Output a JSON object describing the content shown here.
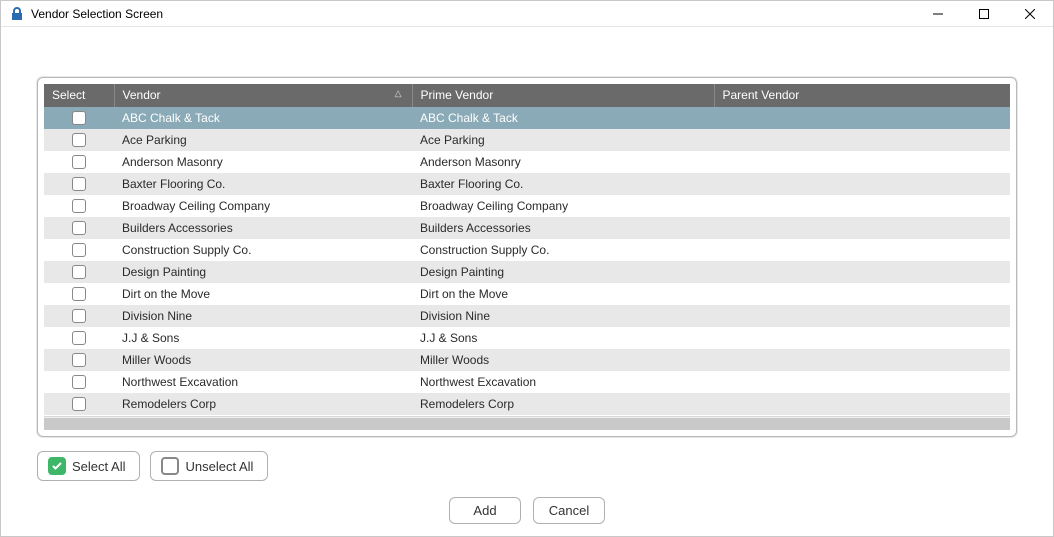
{
  "window": {
    "title": "Vendor Selection Screen"
  },
  "columns": {
    "select": "Select",
    "vendor": "Vendor",
    "prime": "Prime Vendor",
    "parent": "Parent Vendor"
  },
  "rows": [
    {
      "checked": false,
      "vendor": "ABC Chalk & Tack",
      "prime": "ABC Chalk & Tack",
      "parent": "",
      "selected": true
    },
    {
      "checked": false,
      "vendor": "Ace Parking",
      "prime": "Ace Parking",
      "parent": "",
      "selected": false
    },
    {
      "checked": false,
      "vendor": "Anderson Masonry",
      "prime": "Anderson Masonry",
      "parent": "",
      "selected": false
    },
    {
      "checked": false,
      "vendor": "Baxter Flooring Co.",
      "prime": "Baxter Flooring Co.",
      "parent": "",
      "selected": false
    },
    {
      "checked": false,
      "vendor": "Broadway Ceiling Company",
      "prime": "Broadway Ceiling Company",
      "parent": "",
      "selected": false
    },
    {
      "checked": false,
      "vendor": "Builders Accessories",
      "prime": "Builders Accessories",
      "parent": "",
      "selected": false
    },
    {
      "checked": false,
      "vendor": "Construction Supply Co.",
      "prime": "Construction Supply Co.",
      "parent": "",
      "selected": false
    },
    {
      "checked": false,
      "vendor": "Design Painting",
      "prime": "Design Painting",
      "parent": "",
      "selected": false
    },
    {
      "checked": false,
      "vendor": "Dirt on the Move",
      "prime": "Dirt on the Move",
      "parent": "",
      "selected": false
    },
    {
      "checked": false,
      "vendor": "Division Nine",
      "prime": "Division Nine",
      "parent": "",
      "selected": false
    },
    {
      "checked": false,
      "vendor": "J.J & Sons",
      "prime": "J.J & Sons",
      "parent": "",
      "selected": false
    },
    {
      "checked": false,
      "vendor": "Miller Woods",
      "prime": "Miller Woods",
      "parent": "",
      "selected": false
    },
    {
      "checked": false,
      "vendor": "Northwest Excavation",
      "prime": "Northwest Excavation",
      "parent": "",
      "selected": false
    },
    {
      "checked": false,
      "vendor": "Remodelers Corp",
      "prime": "Remodelers Corp",
      "parent": "",
      "selected": false
    }
  ],
  "buttons": {
    "select_all": "Select All",
    "unselect_all": "Unselect All",
    "add": "Add",
    "cancel": "Cancel"
  }
}
